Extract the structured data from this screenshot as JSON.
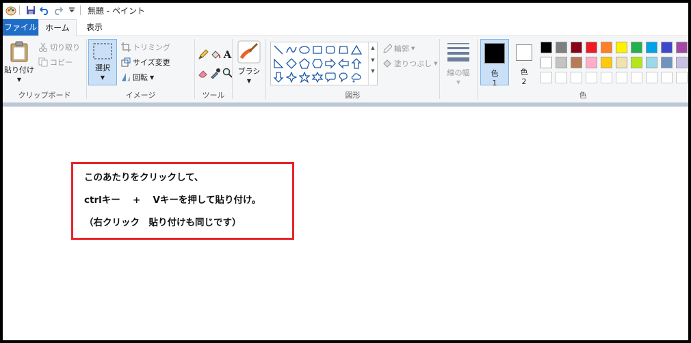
{
  "window": {
    "title": "無題 - ペイント"
  },
  "tabs": [
    {
      "label": "ファイル"
    },
    {
      "label": "ホーム"
    },
    {
      "label": "表示"
    }
  ],
  "clipboard": {
    "paste": "貼り付け",
    "cut": "切り取り",
    "copy": "コピー",
    "group": "クリップボード"
  },
  "image": {
    "select": "選択",
    "crop": "トリミング",
    "resize": "サイズ変更",
    "rotate": "回転",
    "group": "イメージ"
  },
  "tools": {
    "group": "ツール"
  },
  "brushes": {
    "label": "ブラシ"
  },
  "shapes": {
    "outline": "輪郭",
    "fill": "塗りつぶし",
    "group": "図形"
  },
  "size": {
    "label": "線の幅"
  },
  "colors": {
    "color1_label": "色",
    "color1_num": "1",
    "color2_label": "色",
    "color2_num": "2",
    "group": "色",
    "color1": "#000000",
    "color2": "#ffffff",
    "palette_row1": [
      "#000000",
      "#7f7f7f",
      "#880015",
      "#ed1c24",
      "#ff7f27",
      "#fff200",
      "#22b14c",
      "#00a2e8",
      "#3f48cc",
      "#a349a4"
    ],
    "palette_row2": [
      "#ffffff",
      "#c3c3c3",
      "#b97a57",
      "#ffaec9",
      "#ffc90e",
      "#efe4b0",
      "#b5e61d",
      "#99d9ea",
      "#7092be",
      "#c8bfe7"
    ],
    "palette_row3": [
      "#ffffff",
      "#ffffff",
      "#ffffff",
      "#ffffff",
      "#ffffff",
      "#ffffff",
      "#ffffff",
      "#ffffff",
      "#ffffff",
      "#ffffff"
    ]
  },
  "note": {
    "line1": "このあたりをクリックして、",
    "line2": "ctrlキー　 +　 Vキーを押して貼り付け。",
    "line3": "（右クリック　貼り付けも同じです）",
    "border_color": "#e8232a"
  }
}
